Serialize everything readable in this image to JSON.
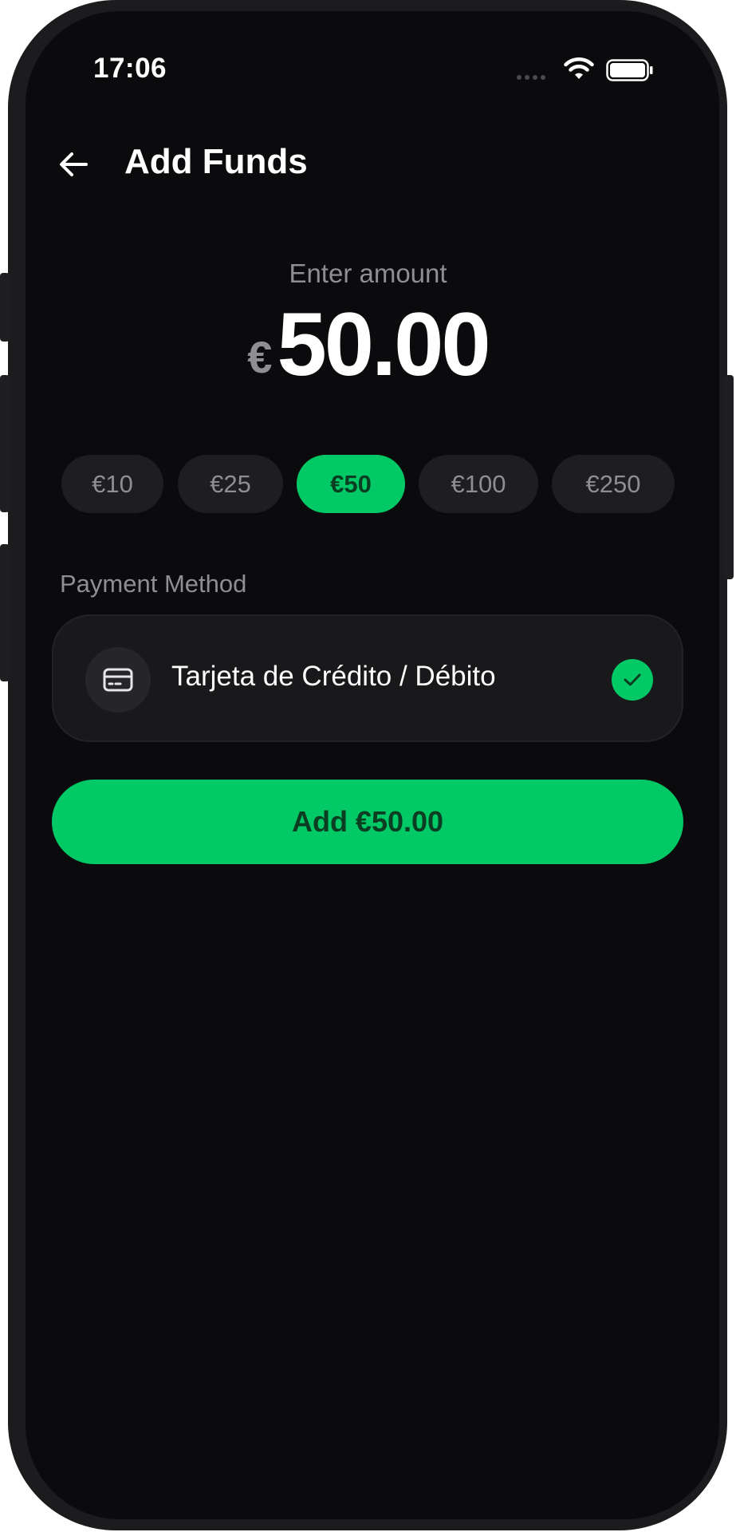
{
  "status_bar": {
    "time": "17:06",
    "signal_icon": "signal-dots-icon",
    "wifi_icon": "wifi-icon",
    "battery_icon": "battery-icon"
  },
  "header": {
    "back_icon": "arrow-left-icon",
    "title": "Add Funds"
  },
  "amount": {
    "label": "Enter amount",
    "currency": "€",
    "value": "50.00"
  },
  "presets": [
    {
      "label": "€10",
      "selected": false
    },
    {
      "label": "€25",
      "selected": false
    },
    {
      "label": "€50",
      "selected": true
    },
    {
      "label": "€100",
      "selected": false
    },
    {
      "label": "€250",
      "selected": false
    }
  ],
  "payment": {
    "section_label": "Payment Method",
    "method_icon": "credit-card-icon",
    "method_label": "Tarjeta de Crédito / Débito",
    "selected_icon": "check-icon",
    "selected": true
  },
  "cta": {
    "label": "Add €50.00"
  },
  "colors": {
    "accent": "#00c965",
    "background": "#0b0b0d",
    "surface": "#1e1e21",
    "muted_text": "#8e8e93",
    "accent_text": "#0a3d22"
  }
}
